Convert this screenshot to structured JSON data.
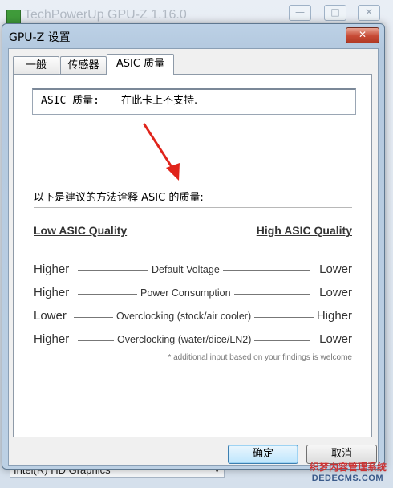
{
  "background_window": {
    "title": "TechPowerUp GPU-Z 1.16.0",
    "controls": [
      "minimize-icon",
      "maximize-icon",
      "close-icon"
    ],
    "dropdown_value": "Intel(R) HD Graphics"
  },
  "dialog": {
    "title": "GPU-Z 设置",
    "close_icon": "close-icon",
    "tabs": [
      {
        "label": "一般",
        "active": false
      },
      {
        "label": "传感器",
        "active": false
      },
      {
        "label": "ASIC 质量",
        "active": true
      }
    ],
    "asic": {
      "label": "ASIC 质量:",
      "value": "在此卡上不支持."
    },
    "explanation": "以下是建议的方法诠释 ASIC 的质量:",
    "table": {
      "low_header": "Low ASIC Quality",
      "high_header": "High ASIC Quality",
      "rows": [
        {
          "low": "Higher",
          "metric": "Default Voltage",
          "high": "Lower"
        },
        {
          "low": "Higher",
          "metric": "Power Consumption",
          "high": "Lower"
        },
        {
          "low": "Lower",
          "metric": "Overclocking (stock/air cooler)",
          "high": "Higher"
        },
        {
          "low": "Higher",
          "metric": "Overclocking (water/dice/LN2)",
          "high": "Lower"
        }
      ],
      "footnote": "* additional input based on your findings is welcome"
    },
    "buttons": {
      "ok": "确定",
      "cancel": "取消"
    }
  },
  "watermark": {
    "line1": "织梦内容管理系统",
    "line2": "DEDECMS.COM"
  },
  "colors": {
    "arrow": "#e0241b",
    "dialog_frame": "#b4c9df",
    "close_button": "#c74a35"
  }
}
